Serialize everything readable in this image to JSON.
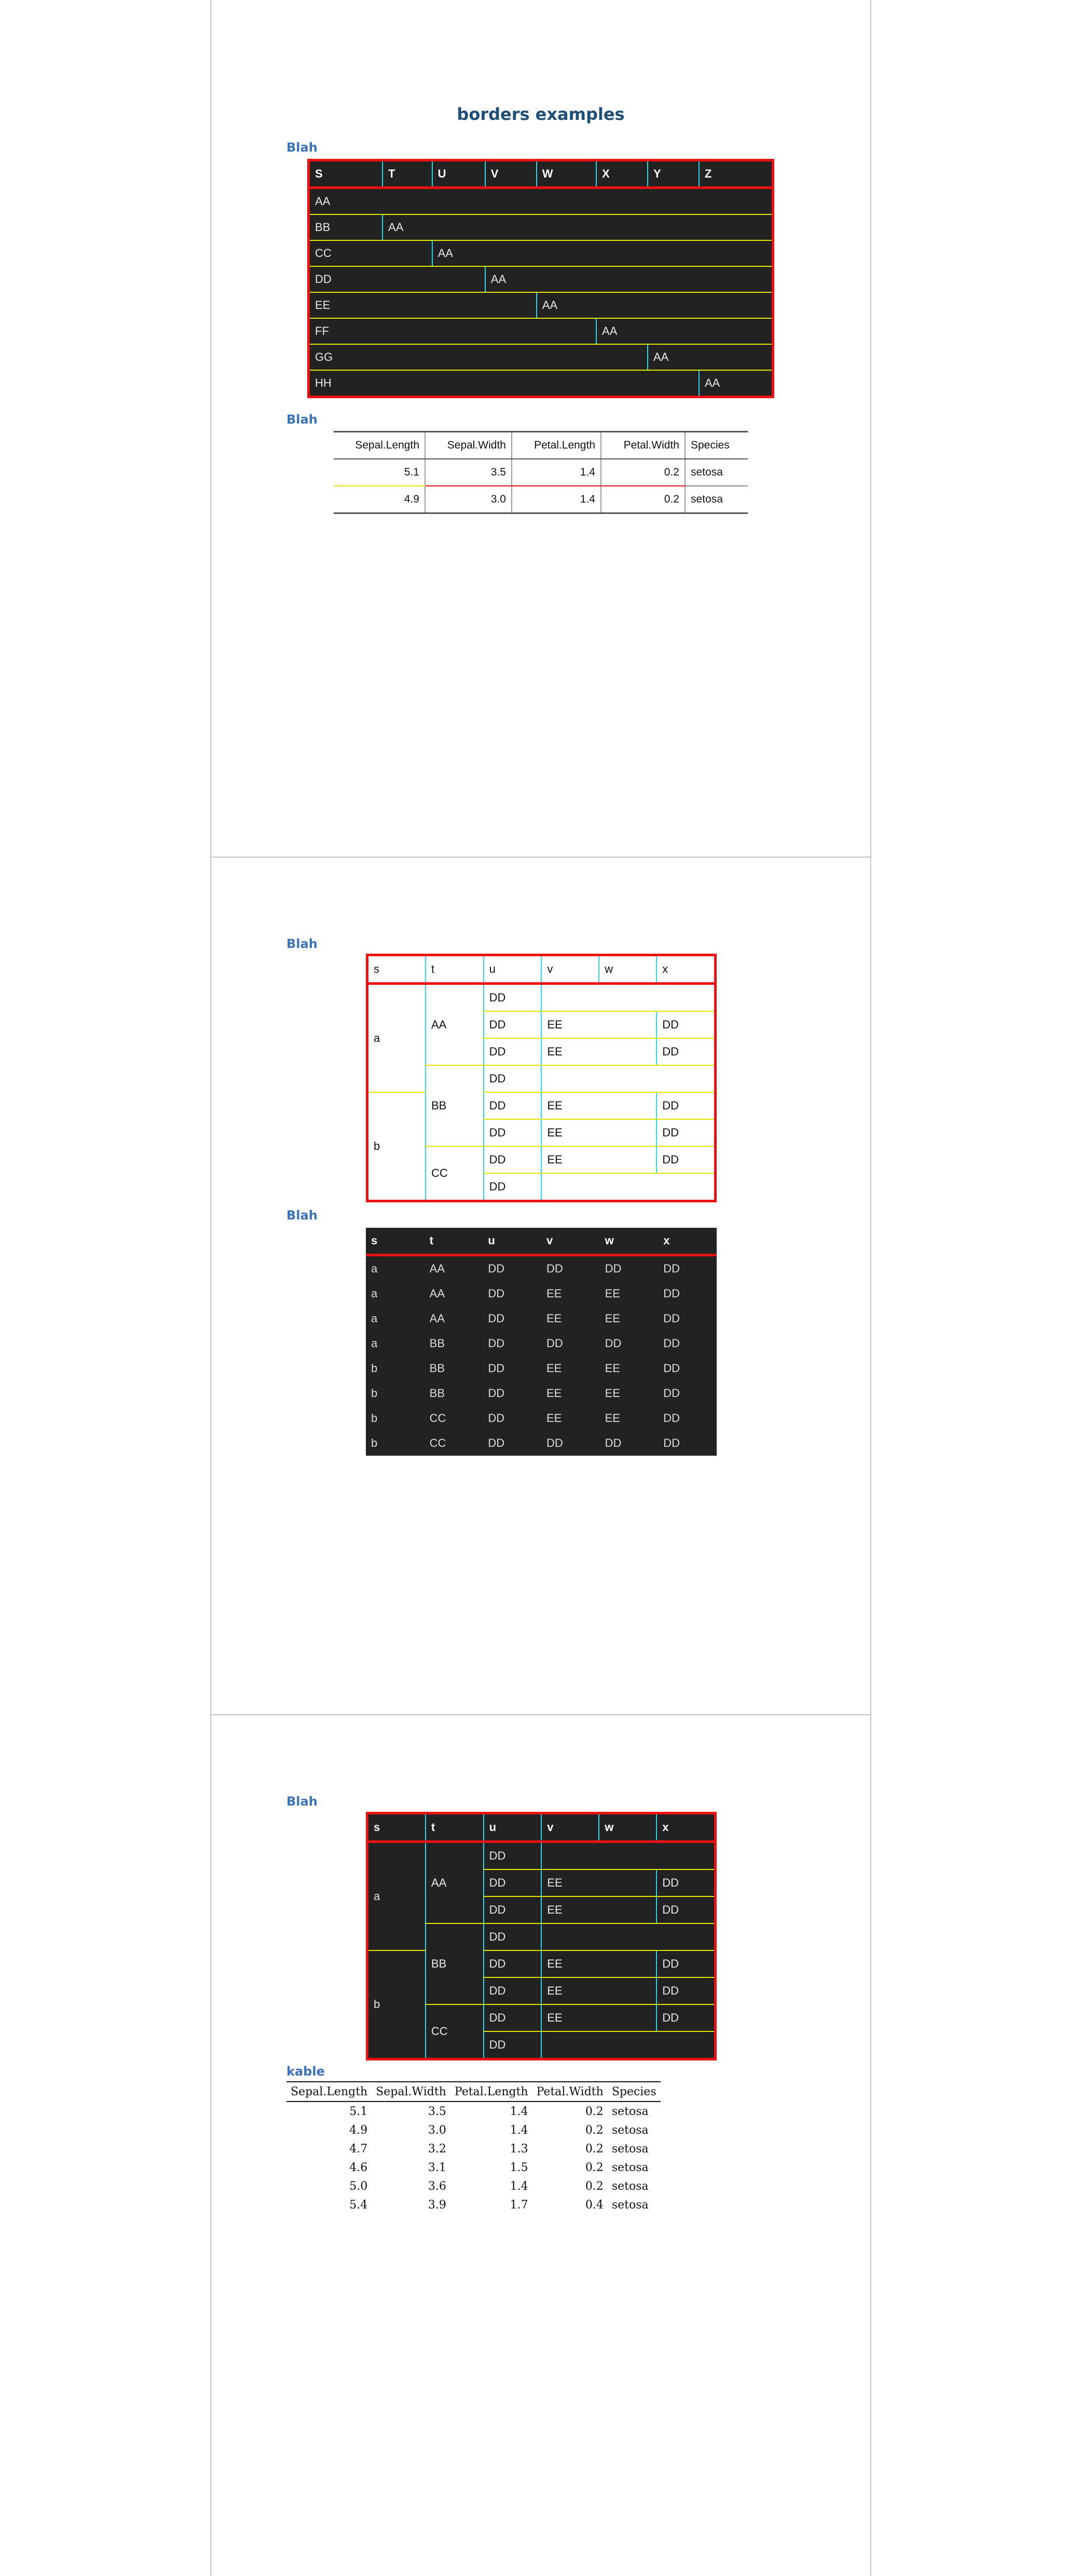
{
  "document": {
    "title": "borders examples",
    "captions": [
      "Blah",
      "Blah",
      "Blah",
      "Blah",
      "Blah",
      "kable"
    ]
  },
  "table1": {
    "headers": [
      "S",
      "T",
      "U",
      "V",
      "W",
      "X",
      "Y",
      "Z"
    ],
    "rows": [
      {
        "lead": "AA",
        "value": ""
      },
      {
        "lead": "BB",
        "value": "AA"
      },
      {
        "lead": "CC",
        "value": "AA"
      },
      {
        "lead": "DD",
        "value": "AA"
      },
      {
        "lead": "EE",
        "value": "AA"
      },
      {
        "lead": "FF",
        "value": "AA"
      },
      {
        "lead": "GG",
        "value": "AA"
      },
      {
        "lead": "HH",
        "value": "AA"
      }
    ]
  },
  "table2": {
    "headers": [
      "Sepal.Length",
      "Sepal.Width",
      "Petal.Length",
      "Petal.Width",
      "Species"
    ],
    "rows": [
      [
        "5.1",
        "3.5",
        "1.4",
        "0.2",
        "setosa"
      ],
      [
        "4.9",
        "3.0",
        "1.4",
        "0.2",
        "setosa"
      ]
    ]
  },
  "table3": {
    "headers": [
      "s",
      "t",
      "u",
      "v",
      "w",
      "x"
    ],
    "group_s": [
      "a",
      "b"
    ],
    "group_t": [
      "AA",
      "BB",
      "CC"
    ],
    "rows": [
      [
        "DD",
        "",
        ""
      ],
      [
        "DD",
        "EE",
        "DD"
      ],
      [
        "DD",
        "EE",
        "DD"
      ],
      [
        "DD",
        "",
        ""
      ],
      [
        "DD",
        "EE",
        "DD"
      ],
      [
        "DD",
        "EE",
        "DD"
      ],
      [
        "DD",
        "EE",
        "DD"
      ],
      [
        "DD",
        "",
        ""
      ]
    ]
  },
  "table4": {
    "headers": [
      "s",
      "t",
      "u",
      "v",
      "w",
      "x"
    ],
    "rows": [
      [
        "a",
        "AA",
        "DD",
        "DD",
        "DD",
        "DD"
      ],
      [
        "a",
        "AA",
        "DD",
        "EE",
        "EE",
        "DD"
      ],
      [
        "a",
        "AA",
        "DD",
        "EE",
        "EE",
        "DD"
      ],
      [
        "a",
        "BB",
        "DD",
        "DD",
        "DD",
        "DD"
      ],
      [
        "b",
        "BB",
        "DD",
        "EE",
        "EE",
        "DD"
      ],
      [
        "b",
        "BB",
        "DD",
        "EE",
        "EE",
        "DD"
      ],
      [
        "b",
        "CC",
        "DD",
        "EE",
        "EE",
        "DD"
      ],
      [
        "b",
        "CC",
        "DD",
        "DD",
        "DD",
        "DD"
      ]
    ]
  },
  "table5": {
    "headers": [
      "s",
      "t",
      "u",
      "v",
      "w",
      "x"
    ],
    "group_s": [
      "a",
      "b"
    ],
    "group_t": [
      "AA",
      "BB",
      "CC"
    ],
    "rows": [
      [
        "DD",
        "",
        ""
      ],
      [
        "DD",
        "EE",
        "DD"
      ],
      [
        "DD",
        "EE",
        "DD"
      ],
      [
        "DD",
        "",
        ""
      ],
      [
        "DD",
        "EE",
        "DD"
      ],
      [
        "DD",
        "EE",
        "DD"
      ],
      [
        "DD",
        "EE",
        "DD"
      ],
      [
        "DD",
        "",
        ""
      ]
    ]
  },
  "kable": {
    "headers": [
      "Sepal.Length",
      "Sepal.Width",
      "Petal.Length",
      "Petal.Width",
      "Species"
    ],
    "rows": [
      [
        "5.1",
        "3.5",
        "1.4",
        "0.2",
        "setosa"
      ],
      [
        "4.9",
        "3.0",
        "1.4",
        "0.2",
        "setosa"
      ],
      [
        "4.7",
        "3.2",
        "1.3",
        "0.2",
        "setosa"
      ],
      [
        "4.6",
        "3.1",
        "1.5",
        "0.2",
        "setosa"
      ],
      [
        "5.0",
        "3.6",
        "1.4",
        "0.2",
        "setosa"
      ],
      [
        "5.4",
        "3.9",
        "1.7",
        "0.4",
        "setosa"
      ]
    ]
  },
  "colors": {
    "border_outer": "#ee1111",
    "border_vertical": "#29d9e6",
    "border_horizontal": "#e6e600",
    "dark_bg": "#222222",
    "title": "#1f4e79",
    "caption": "#3b73b9"
  }
}
